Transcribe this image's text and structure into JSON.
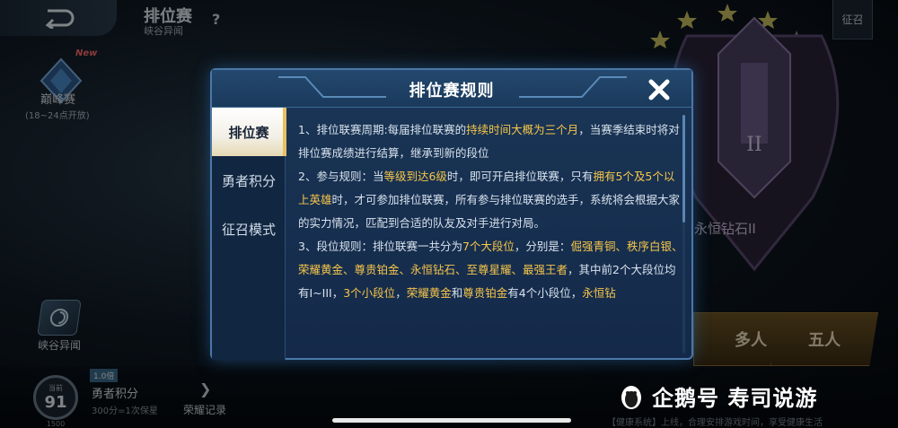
{
  "topbar": {
    "mode_title": "排位赛",
    "mode_subtitle": "峡谷异闻",
    "help_glyph": "?",
    "recruit_label": "征召"
  },
  "left_panel": {
    "new_tag": "New",
    "peak_label": "巅峰赛",
    "peak_time": "(18~24点开放)",
    "rift_label": "峡谷异闻"
  },
  "rank": {
    "name": "永恒钻石II",
    "team_multi": "多人",
    "team_five": "五人"
  },
  "bottom": {
    "score_label": "当前",
    "score_value": "91",
    "score_max": "1500",
    "valor_tag": "1.0倍",
    "valor_label": "勇者积分",
    "valor_sub": "300分=1次保星",
    "honor_label": "荣耀记录",
    "health_tip": "【健康系统】上线，合理安排游戏时间，享受健康生活"
  },
  "watermark": {
    "text": "企鹅号 寿司说游"
  },
  "modal": {
    "title": "排位赛规则",
    "tabs": [
      {
        "label": "排位赛",
        "active": true
      },
      {
        "label": "勇者积分",
        "active": false
      },
      {
        "label": "征召模式",
        "active": false
      }
    ],
    "rules": [
      [
        {
          "t": "1、排位联赛周期:每届排位联赛的"
        },
        {
          "t": "持续时间大概为三个月",
          "hl": true
        },
        {
          "t": "，当赛季结束时将对排位赛成绩进行结算，继承到新的段位"
        }
      ],
      [
        {
          "t": "2、参与规则：当"
        },
        {
          "t": "等级到达6级",
          "hl": true
        },
        {
          "t": "时，即可开启排位联赛，只有"
        },
        {
          "t": "拥有5个及5个以上英雄",
          "hl": true
        },
        {
          "t": "时，才可参加排位联赛，所有参与排位联赛的选手，系统将会根据大家的实力情况，匹配到合适的队友及对手进行对局。"
        }
      ],
      [
        {
          "t": "3、段位规则：排位联赛一共分为"
        },
        {
          "t": "7个大段位",
          "hl": true
        },
        {
          "t": "，分别是："
        },
        {
          "t": "倔强青铜、秩序白银、荣耀黄金、尊贵铂金、永恒钻石、至尊星耀、最强王者",
          "hl": true
        },
        {
          "t": "，其中前2个大段位均有I~III，"
        },
        {
          "t": "3个小段位",
          "hl": true
        },
        {
          "t": "，"
        },
        {
          "t": "荣耀黄金",
          "hl": true
        },
        {
          "t": "和"
        },
        {
          "t": "尊贵铂金",
          "hl": true
        },
        {
          "t": "有4个小段位，"
        },
        {
          "t": "永恒钻",
          "hl": true
        }
      ]
    ]
  },
  "colors": {
    "highlight": "#f6c64a",
    "modal_bg": "#14294a",
    "modal_border": "#4a78a8",
    "active_tab_bg": "#f2efe6"
  },
  "icons": {
    "back": "back-arrow-icon",
    "close": "close-icon",
    "help": "question-icon"
  }
}
